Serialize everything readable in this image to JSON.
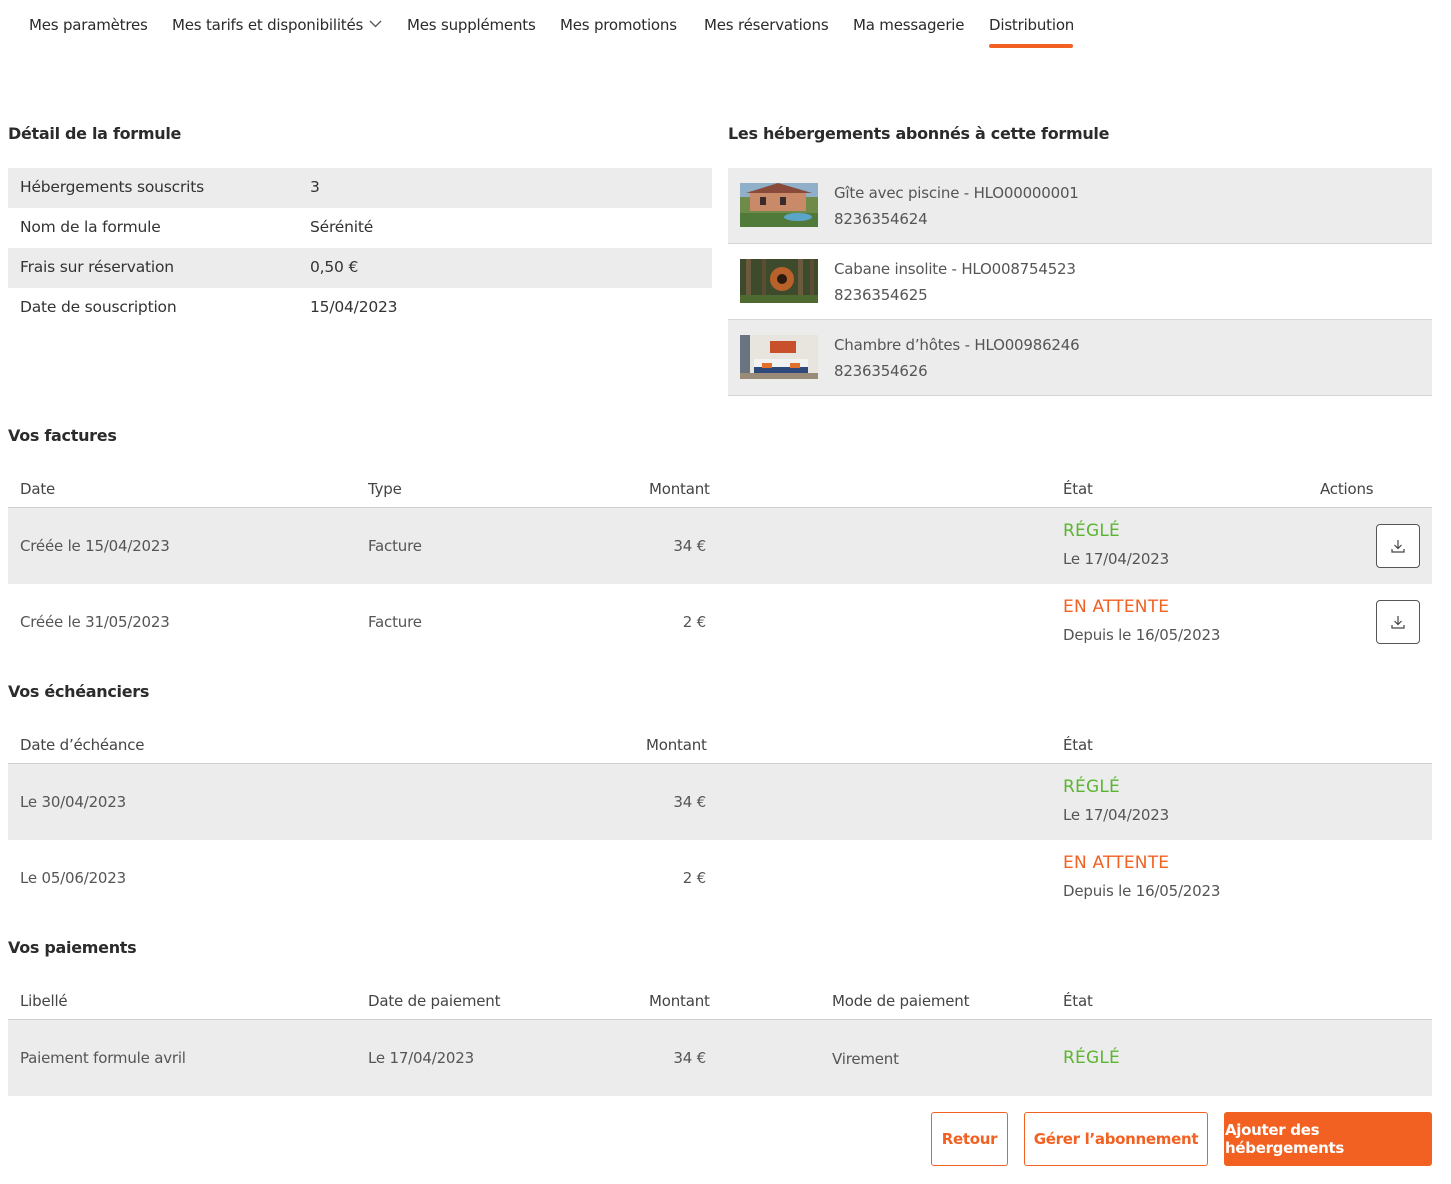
{
  "nav": {
    "items": [
      {
        "label": "Mes paramètres"
      },
      {
        "label": "Mes tarifs et disponibilités"
      },
      {
        "label": "Mes suppléments"
      },
      {
        "label": "Mes promotions"
      },
      {
        "label": "Mes réservations"
      },
      {
        "label": "Ma messagerie"
      },
      {
        "label": "Distribution"
      }
    ],
    "active": "Distribution"
  },
  "formula_detail": {
    "title": "Détail de la formule",
    "rows": [
      {
        "key": "Hébergements souscrits",
        "value": "3"
      },
      {
        "key": "Nom de la formule",
        "value": "Sérénité"
      },
      {
        "key": "Frais sur réservation",
        "value": "0,50 €"
      },
      {
        "key": "Date de souscription",
        "value": "15/04/2023"
      }
    ]
  },
  "subscribed": {
    "title": "Les hébergements abonnés à cette formule",
    "items": [
      {
        "name": "Gîte avec piscine - HLO00000001",
        "ref": "8236354624"
      },
      {
        "name": "Cabane insolite - HLO008754523",
        "ref": "8236354625"
      },
      {
        "name": "Chambre d’hôtes - HLO00986246",
        "ref": "8236354626"
      }
    ]
  },
  "invoices": {
    "title": "Vos factures",
    "headers": {
      "date": "Date",
      "type": "Type",
      "amount": "Montant",
      "state": "État",
      "actions": "Actions"
    },
    "rows": [
      {
        "date": "Créée le 15/04/2023",
        "type": "Facture",
        "amount": "34 €",
        "state": "RÉGLÉ",
        "state_sub": "Le 17/04/2023"
      },
      {
        "date": "Créée le 31/05/2023",
        "type": "Facture",
        "amount": "2 €",
        "state": "EN ATTENTE",
        "state_sub": "Depuis le 16/05/2023"
      }
    ]
  },
  "schedules": {
    "title": "Vos échéanciers",
    "headers": {
      "due_date": "Date d’échéance",
      "amount": "Montant",
      "state": "État"
    },
    "rows": [
      {
        "due_date": "Le 30/04/2023",
        "amount": "34 €",
        "state": "RÉGLÉ",
        "state_sub": "Le 17/04/2023"
      },
      {
        "due_date": "Le 05/06/2023",
        "amount": "2 €",
        "state": "EN ATTENTE",
        "state_sub": "Depuis le 16/05/2023"
      }
    ]
  },
  "payments": {
    "title": "Vos paiements",
    "headers": {
      "label": "Libellé",
      "date": "Date de paiement",
      "amount": "Montant",
      "mode": "Mode de paiement",
      "state": "État"
    },
    "rows": [
      {
        "label": "Paiement formule avril",
        "date": "Le 17/04/2023",
        "amount": "34 €",
        "mode": "Virement",
        "state": "RÉGLÉ"
      }
    ]
  },
  "buttons": {
    "back": "Retour",
    "manage": "Gérer l’abonnement",
    "add": "Ajouter des hébergements"
  },
  "colors": {
    "accent": "#f26122",
    "success": "#5cb531",
    "row_shade": "#ececec"
  },
  "icons": {
    "download": "download-icon",
    "dropdown": "chevron-down-icon"
  }
}
